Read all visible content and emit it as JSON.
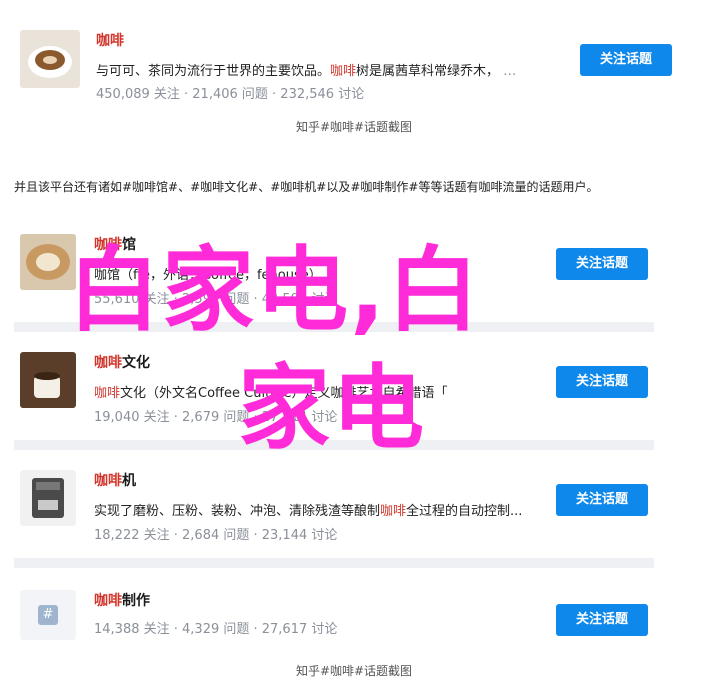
{
  "top_card": {
    "title": "咖啡",
    "desc_a": "与可可、茶同为流行于世界的主要饮品。",
    "desc_hl": "咖啡",
    "desc_b": "树是属茜草科常绿乔木，",
    "menu_icon": "more-icon",
    "stats": "450,089 关注 · 21,406 问题 · 232,546 讨论",
    "button": "关注话题"
  },
  "caption_top": "知乎#咖啡#话题截图",
  "paragraph": "并且该平台还有诸如#咖啡馆#、#咖啡文化#、#咖啡机#以及#咖啡制作#等等话题有咖啡流量的话题用户。",
  "topics": [
    {
      "title_hl": "咖啡",
      "title_rest": "馆",
      "desc_a": "咖",
      "desc_hl": "",
      "desc_b": "馆（ffe，外语：Coffee，fehouse）",
      "stats": "55,610 关注 · 2,597 问题 · 42,597 讨论",
      "button": "关注话题"
    },
    {
      "title_hl": "咖啡",
      "title_rest": "文化",
      "desc_a": "",
      "desc_hl": "咖啡",
      "desc_b": "文化（外文名Coffee Culture）定义咖啡艺术自希腊语「",
      "stats": "19,040 关注 · 2,679 问题 · 27,714 讨论",
      "button": "关注话题"
    },
    {
      "title_hl": "咖啡",
      "title_rest": "机",
      "desc_a": "实现了磨粉、压粉、装粉、冲泡、清除残渣等酿制",
      "desc_hl": "咖啡",
      "desc_b": "全过程的自动控制...",
      "stats": "18,222 关注 · 2,684 问题 · 23,144 讨论",
      "button": "关注话题"
    },
    {
      "title_hl": "咖啡",
      "title_rest": "制作",
      "desc_a": "",
      "desc_hl": "",
      "desc_b": "",
      "stats": "14,388 关注 · 4,329 问题 · 27,617 讨论",
      "button": "关注话题"
    }
  ],
  "caption_bottom": "知乎#咖啡#话题截图",
  "watermark": {
    "line1": "白家电,白",
    "line2": "家电",
    "color": "#ff2bd9"
  },
  "colors": {
    "accent": "#0f88eb",
    "title": "#d2352b",
    "muted": "#8a8f99"
  }
}
